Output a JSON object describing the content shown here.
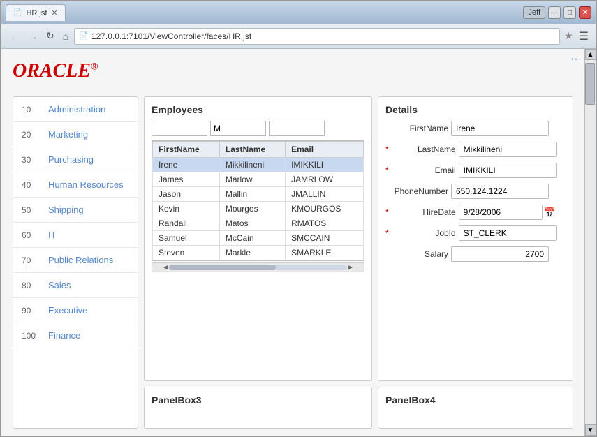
{
  "browser": {
    "tab_label": "HR.jsf",
    "tab_icon": "📄",
    "url": "127.0.0.1:7101/ViewController/faces/HR.jsf",
    "user_badge": "Jeff",
    "dots": "···",
    "back_btn": "←",
    "forward_btn": "→",
    "refresh_btn": "↻",
    "home_btn": "⌂"
  },
  "oracle_logo": "ORACLE",
  "oracle_reg": "®",
  "sidebar": {
    "items": [
      {
        "num": "10",
        "label": "Administration"
      },
      {
        "num": "20",
        "label": "Marketing"
      },
      {
        "num": "30",
        "label": "Purchasing"
      },
      {
        "num": "40",
        "label": "Human Resources"
      },
      {
        "num": "50",
        "label": "Shipping"
      },
      {
        "num": "60",
        "label": "IT"
      },
      {
        "num": "70",
        "label": "Public Relations"
      },
      {
        "num": "80",
        "label": "Sales"
      },
      {
        "num": "90",
        "label": "Executive"
      },
      {
        "num": "100",
        "label": "Finance"
      }
    ]
  },
  "employees": {
    "title": "Employees",
    "filter": {
      "val1": "",
      "val2": "M",
      "val3": ""
    },
    "columns": [
      "FirstName",
      "LastName",
      "Email"
    ],
    "rows": [
      {
        "first": "Irene",
        "last": "Mikkilineni",
        "email": "IMIKKILI",
        "selected": true
      },
      {
        "first": "James",
        "last": "Marlow",
        "email": "JAMRLOW",
        "selected": false
      },
      {
        "first": "Jason",
        "last": "Mallin",
        "email": "JMALLIN",
        "selected": false
      },
      {
        "first": "Kevin",
        "last": "Mourgos",
        "email": "KMOURGOS",
        "selected": false
      },
      {
        "first": "Randall",
        "last": "Matos",
        "email": "RMATOS",
        "selected": false
      },
      {
        "first": "Samuel",
        "last": "McCain",
        "email": "SMCCAIN",
        "selected": false
      },
      {
        "first": "Steven",
        "last": "Markle",
        "email": "SMARKLE",
        "selected": false
      }
    ]
  },
  "details": {
    "title": "Details",
    "fields": {
      "first_name_label": "FirstName",
      "first_name_value": "Irene",
      "last_name_label": "LastName",
      "last_name_value": "Mikkilineni",
      "email_label": "Email",
      "email_value": "IMIKKILI",
      "phone_label": "PhoneNumber",
      "phone_value": "650.124.1224",
      "hire_date_label": "HireDate",
      "hire_date_value": "9/28/2006",
      "job_id_label": "JobId",
      "job_id_value": "ST_CLERK",
      "salary_label": "Salary",
      "salary_value": "2700"
    }
  },
  "panel_box3_title": "PanelBox3",
  "panel_box4_title": "PanelBox4"
}
